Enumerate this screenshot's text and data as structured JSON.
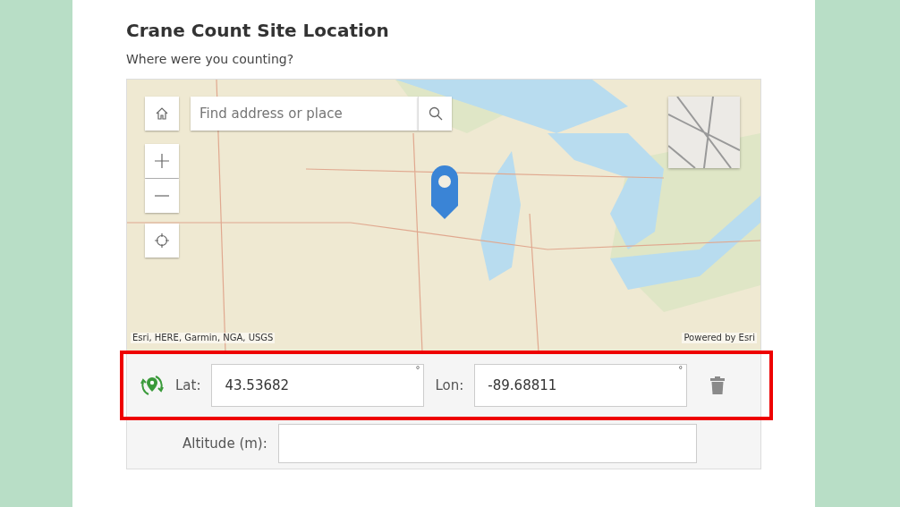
{
  "title": "Crane Count Site Location",
  "question": "Where were you counting?",
  "map": {
    "search": {
      "placeholder": "Find address or place"
    },
    "attribution": "Esri, HERE, Garmin, NGA, USGS",
    "powered_by": "Powered by Esri"
  },
  "location": {
    "lat_label": "Lat:",
    "lat_value": "43.53682",
    "lat_unit": "°",
    "lon_label": "Lon:",
    "lon_value": "-89.68811",
    "lon_unit": "°"
  },
  "altitude": {
    "label": "Altitude (m):"
  },
  "highlight": {
    "on": true
  }
}
